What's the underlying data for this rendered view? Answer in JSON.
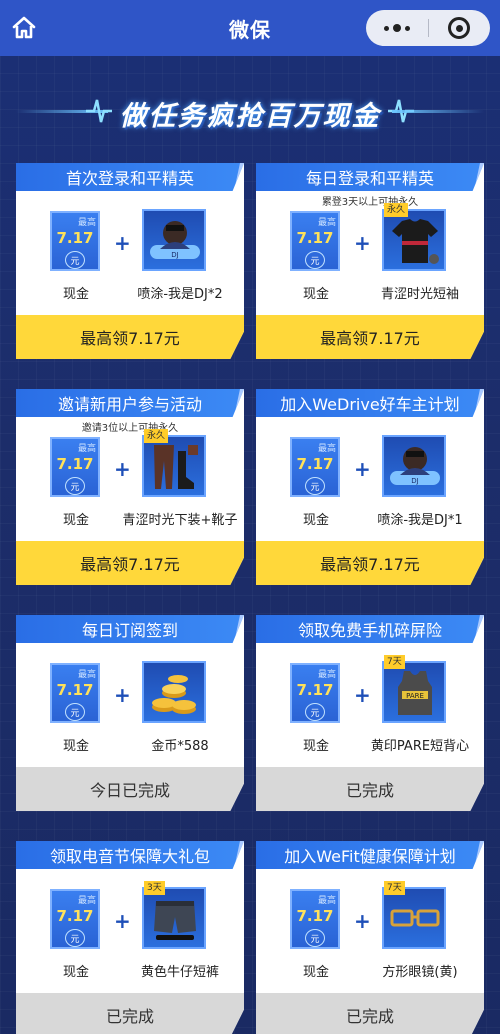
{
  "navbar": {
    "title": "微保",
    "home_icon": "home-icon",
    "menu_icon": "more-dots-icon",
    "close_icon": "miniprogram-close-icon"
  },
  "banner": {
    "title": "做任务疯抢百万现金"
  },
  "cash_badge": {
    "top": "最高",
    "amount": "7.17",
    "unit": "元"
  },
  "cards": [
    {
      "title": "首次登录和平精英",
      "subtitle": "",
      "cash_label": "现金",
      "item_label": "喷涂-我是DJ*2",
      "item_badge": "",
      "item_icon": "spray-dj-icon",
      "footer": "最高领7.17元",
      "status": "active"
    },
    {
      "title": "每日登录和平精英",
      "subtitle": "累登3天以上可抽永久",
      "cash_label": "现金",
      "item_label": "青涩时光短袖",
      "item_badge": "永久",
      "item_icon": "tshirt-icon",
      "footer": "最高领7.17元",
      "status": "active"
    },
    {
      "title": "邀请新用户参与活动",
      "subtitle": "邀请3位以上可抽永久",
      "cash_label": "现金",
      "item_label": "青涩时光下装+靴子",
      "item_badge": "永久",
      "item_icon": "pants-boots-icon",
      "footer": "最高领7.17元",
      "status": "active"
    },
    {
      "title": "加入WeDrive好车主计划",
      "subtitle": "",
      "cash_label": "现金",
      "item_label": "喷涂-我是DJ*1",
      "item_badge": "",
      "item_icon": "spray-dj-icon",
      "footer": "最高领7.17元",
      "status": "active"
    },
    {
      "title": "每日订阅签到",
      "subtitle": "",
      "cash_label": "现金",
      "item_label": "金币*588",
      "item_badge": "",
      "item_icon": "gold-coins-icon",
      "footer": "今日已完成",
      "status": "done"
    },
    {
      "title": "领取免费手机碎屏险",
      "subtitle": "",
      "cash_label": "现金",
      "item_label": "黄印PARE短背心",
      "item_badge": "7天",
      "item_icon": "vest-icon",
      "footer": "已完成",
      "status": "done"
    },
    {
      "title": "领取电音节保障大礼包",
      "subtitle": "",
      "cash_label": "现金",
      "item_label": "黄色牛仔短裤",
      "item_badge": "3天",
      "item_icon": "denim-shorts-icon",
      "footer": "已完成",
      "status": "done"
    },
    {
      "title": "加入WeFit健康保障计划",
      "subtitle": "",
      "cash_label": "现金",
      "item_label": "方形眼镜(黄)",
      "item_badge": "7天",
      "item_icon": "square-glasses-icon",
      "footer": "已完成",
      "status": "done"
    }
  ],
  "colors": {
    "navbar": "#2f55c7",
    "background": "#1a2b6b",
    "card_header": "#2a6ee6",
    "footer_active": "#ffd83a",
    "footer_done": "#d8d8d8",
    "cash_amount": "#ffe25a"
  }
}
